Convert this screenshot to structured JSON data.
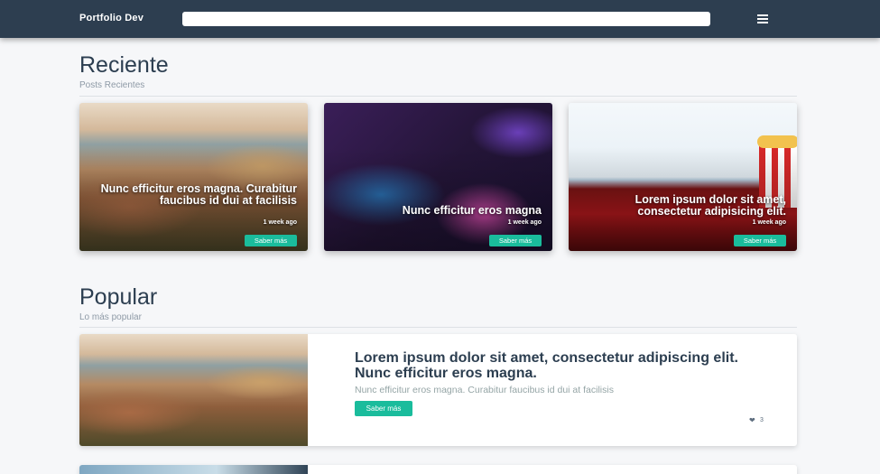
{
  "navbar": {
    "brand": "Portfolio Dev",
    "search_placeholder": "",
    "menu_icon": "hamburger-icon"
  },
  "recent": {
    "title": "Reciente",
    "subtitle": "Posts Recientes",
    "cards": [
      {
        "title": "Nunc efficitur eros magna. Curabitur faucibus id dui at facilisis",
        "time": "1 week ago",
        "button": "Saber más"
      },
      {
        "title": "Nunc efficitur eros magna",
        "time": "1 week ago",
        "button": "Saber más"
      },
      {
        "title": "Lorem ipsum dolor sit amet, consectetur adipisicing elit.",
        "time": "1 week ago",
        "button": "Saber más"
      }
    ]
  },
  "popular": {
    "title": "Popular",
    "subtitle": "Lo más popular",
    "post": {
      "title": "Lorem ipsum dolor sit amet, consectetur adipiscing elit. Nunc efficitur eros magna.",
      "excerpt": "Nunc efficitur eros magna. Curabitur faucibus id dui at facilisis",
      "button": "Saber más",
      "likes": "3",
      "like_icon": "heart-icon"
    }
  },
  "colors": {
    "navbar": "#2d3e50",
    "accent": "#1abc9c",
    "text": "#2c3e50"
  }
}
